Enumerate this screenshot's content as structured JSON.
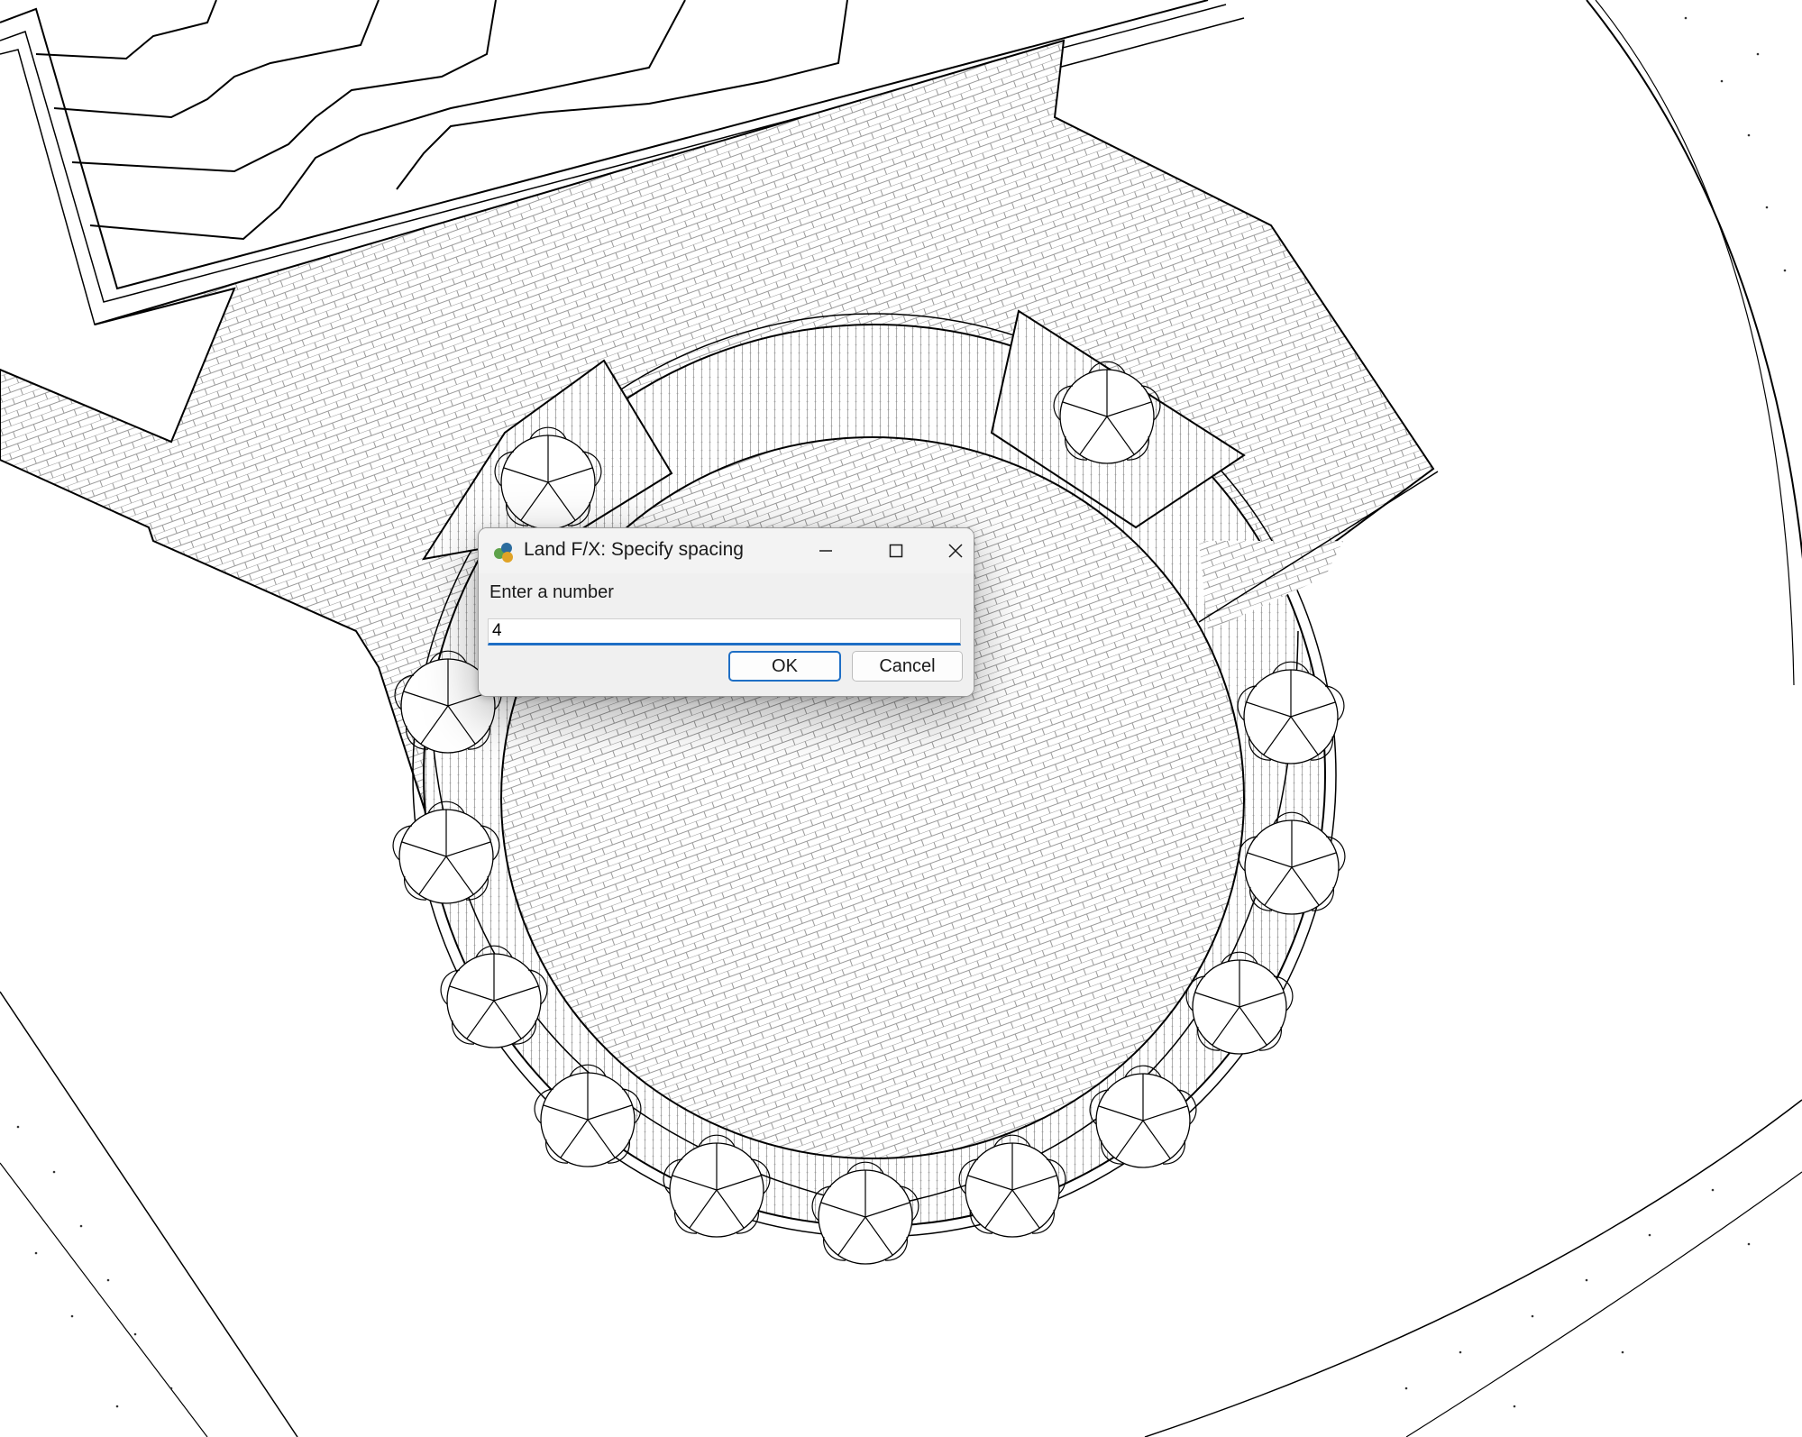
{
  "dialog": {
    "title": "Land F/X: Specify spacing",
    "prompt": "Enter a number",
    "input_value": "4",
    "ok_label": "OK",
    "cancel_label": "Cancel",
    "accent_color": "#1f6fc5"
  },
  "icons": {
    "app": "land-fx-icon",
    "minimize": "minimize-icon",
    "maximize": "maximize-icon",
    "close": "close-icon"
  }
}
